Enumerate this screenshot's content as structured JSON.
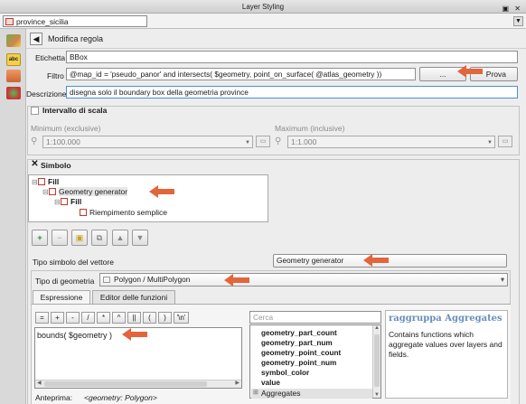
{
  "window": {
    "title": "Layer Styling",
    "controls": "▣ ✕"
  },
  "layer_select": {
    "value": "province_sicilia"
  },
  "toolbar": {
    "back_symbol": "◀",
    "title": "Modifica regola"
  },
  "rule": {
    "label_label": "Etichetta",
    "label_value": "BBox",
    "filter_label": "Filtro",
    "filter_value": "@map_id = 'pseudo_panor' and  intersects( $geometry,    point_on_surface( @atlas_geometry ))",
    "filter_button": "...",
    "test_button": "Prova",
    "description_label": "Descrizione",
    "description_value": "disegna solo il boundary box della geometria province"
  },
  "scale_range": {
    "title": "Intervallo di scala",
    "checkbox": "",
    "minimum_label": "Minimum (exclusive)",
    "minimum_value": "1:100.000",
    "maximum_label": "Maximum (inclusive)",
    "maximum_value": "1:1.000"
  },
  "symbol": {
    "title": "Simbolo",
    "checkbox": "✕",
    "tree": [
      {
        "expander": "⊟",
        "label": "Fill"
      },
      {
        "expander": "⊟",
        "label": "Geometry generator"
      },
      {
        "expander": "⊟",
        "label": "Fill"
      },
      {
        "expander": "",
        "label": "Riempimento semplice"
      }
    ],
    "tree_buttons": [
      "+",
      "−",
      "▣",
      "⧉",
      "▲",
      "▼"
    ]
  },
  "symbol_type": {
    "label": "Tipo simbolo del vettore",
    "value": "Geometry generator"
  },
  "geometry_type": {
    "label": "Tipo di geometria",
    "value": "Polygon / MultiPolygon",
    "dropdown": "▾"
  },
  "tabs": [
    {
      "label": "Espressione"
    },
    {
      "label": "Editor delle funzioni"
    }
  ],
  "operators": [
    "=",
    "+",
    "-",
    "/",
    "*",
    "^",
    "||",
    "(",
    ")",
    "'\\n'"
  ],
  "expression": {
    "text": "bounds( $geometry )"
  },
  "search": {
    "placeholder": "Cerca"
  },
  "functions": [
    "geometry_part_count",
    "geometry_part_num",
    "geometry_point_count",
    "geometry_point_num",
    "symbol_color",
    "value",
    "Aggregates"
  ],
  "help": {
    "title": "raggruppa Aggregates",
    "body": "Contains functions which aggregate values over layers and fields."
  },
  "preview": {
    "label": "Anteprima:",
    "value": "<geometry: Polygon>"
  },
  "colors": {
    "accent_arrow": "#e2653c",
    "symbol_red": "#c0392b"
  }
}
